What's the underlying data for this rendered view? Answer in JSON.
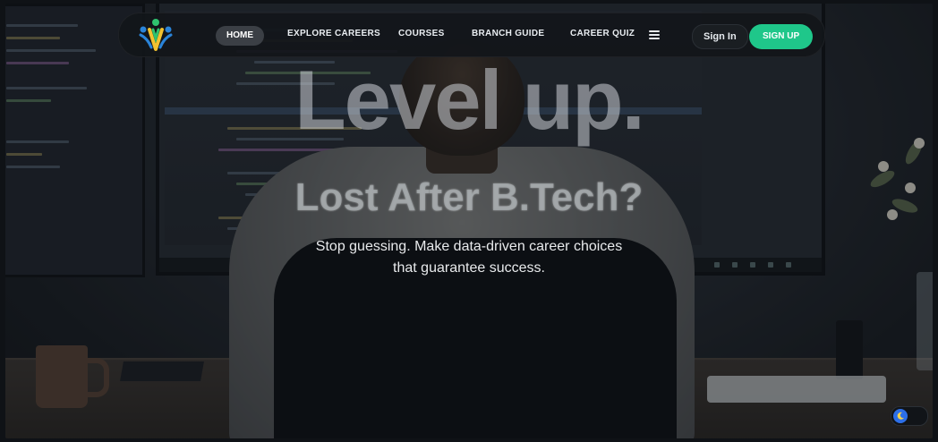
{
  "background": {
    "word": "Level up."
  },
  "navbar": {
    "logo_alt": "logo",
    "links": [
      "HOME",
      "EXPLORE CAREERS",
      "COURSES",
      "BRANCH GUIDE",
      "CAREER QUIZ"
    ],
    "signin_label": "Sign In",
    "signup_label": "SIGN UP",
    "menu_icon": "hamburger-icon",
    "accent": "#1fc78a"
  },
  "hero": {
    "title": "Lost After B.Tech?",
    "subtitle_line1": "Stop guessing. Make data-driven career choices",
    "subtitle_line2": "that guarantee success."
  },
  "theme_toggle": {
    "icon": "moon-icon",
    "color": "#2d6fe8"
  }
}
